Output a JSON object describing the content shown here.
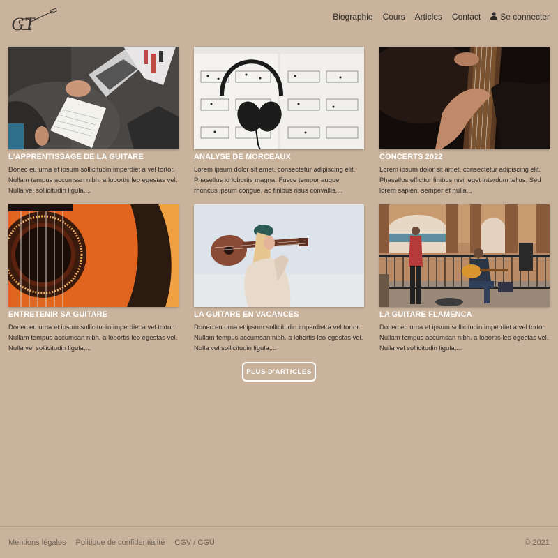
{
  "header": {
    "logo_text": "GT",
    "nav": [
      {
        "label": "Biographie"
      },
      {
        "label": "Cours"
      },
      {
        "label": "Articles"
      },
      {
        "label": "Contact"
      }
    ],
    "login_label": "Se connecter"
  },
  "articles": [
    {
      "title": "L'APPRENTISSAGE DE LA GUITARE",
      "excerpt": "Donec eu urna et ipsum sollicitudin imperdiet a vel tortor. Nullam tempus accumsan nibh, a lobortis leo egestas vel. Nulla vel sollicitudin ligula,..."
    },
    {
      "title": "ANALYSE DE MORCEAUX",
      "excerpt": "Lorem ipsum dolor sit amet, consectetur adipiscing elit. Phasellus id lobortis magna. Fusce tempor augue rhoncus ipsum congue, ac finibus risus convallis...."
    },
    {
      "title": "CONCERTS 2022",
      "excerpt": "Lorem ipsum dolor sit amet, consectetur adipiscing elit. Phasellus efficitur finibus nisi, eget interdum tellus. Sed lorem sapien, semper et nulla..."
    },
    {
      "title": "ENTRETENIR SA GUITARE",
      "excerpt": "Donec eu urna et ipsum sollicitudin imperdiet a vel tortor. Nullam tempus accumsan nibh, a lobortis leo egestas vel. Nulla vel sollicitudin ligula,..."
    },
    {
      "title": "LA GUITARE EN VACANCES",
      "excerpt": "Donec eu urna et ipsum sollicitudin imperdiet a vel tortor. Nullam tempus accumsan nibh, a lobortis leo egestas vel. Nulla vel sollicitudin ligula,..."
    },
    {
      "title": "LA GUITARE FLAMENCA",
      "excerpt": "Donec eu urna et ipsum sollicitudin imperdiet a vel tortor. Nullam tempus accumsan nibh, a lobortis leo egestas vel. Nulla vel sollicitudin ligula,..."
    }
  ],
  "more_button_label": "PLUS D'ARTICLES",
  "footer": {
    "links": [
      {
        "label": "Mentions légales"
      },
      {
        "label": "Politique de confidentialité"
      },
      {
        "label": "CGV / CGU"
      }
    ],
    "copyright": "© 2021"
  },
  "colors": {
    "background": "#c9b39c",
    "card_title": "#ffffff",
    "footer_text": "#6d6156"
  }
}
